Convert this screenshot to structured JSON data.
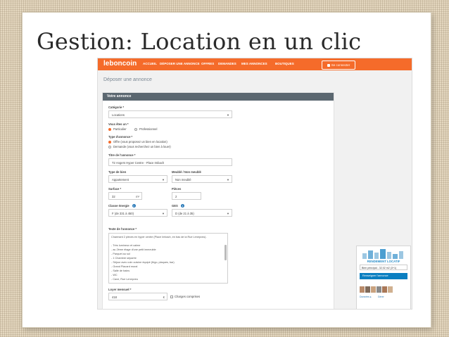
{
  "slide": {
    "title": "Gestion: Location en un clic"
  },
  "site": {
    "logo": "leboncoin",
    "nav": [
      "ACCUEIL",
      "DÉPOSER UNE ANNONCE",
      "OFFRES",
      "DEMANDES",
      "MES ANNONCES",
      "BOUTIQUES"
    ],
    "connect_label": "Se connecter",
    "brand_color": "#f56b2a"
  },
  "page": {
    "heading": "Déposer une annonce"
  },
  "form": {
    "panel_title": "Votre annonce",
    "category_label": "Catégorie *",
    "category_value": "Locations",
    "vous_etes_label": "Vous êtes un *",
    "vous_etes_options": [
      "Particulier",
      "Professionnel"
    ],
    "type_label": "Type d'annonce *",
    "type_options": [
      "Offre (vous proposez un bien en location)",
      "Demande (vous recherchez un bien à louer)"
    ],
    "titre_label": "Titre de l'annonce *",
    "titre_value": "T2 Angers Hyper Centre - Place Imbach",
    "type_bien_label": "Type de bien",
    "type_bien_value": "Appartement",
    "meuble_label": "Meublé / Non meublé",
    "meuble_value": "Non meublé",
    "surface_label": "Surface *",
    "surface_value": "32",
    "surface_unit": "m²",
    "pieces_label": "Pièces",
    "pieces_value": "2",
    "classe_label": "Classe énergie",
    "classe_value": "F (de 331 à 450)",
    "ges_label": "GES",
    "ges_value": "D (de 21 à 35)",
    "texte_label": "Texte de l'annonce *",
    "texte_lines": [
      "Charmant 2 pièces en hyper centre (Place Imbach, en bas de la Rue Lenepveu).",
      "",
      "- Très lumineux et calme",
      "- au 2ème étage d'une petit immeuble",
      "- Parquet au sol",
      "- 1 Chambre séparée",
      "- Séjour avec coin cuisine équipé (frigo, plaques, bar)",
      "- Grand Placard mural",
      "- Salle de bains",
      "- WC",
      "- Cave, Rue Lenepveu"
    ],
    "loyer_label": "Loyer mensuel *",
    "loyer_value": "418",
    "loyer_unit": "€",
    "charges_label": "Charges comprises"
  },
  "widget": {
    "brand": "RENDEMENT LOCATIF",
    "select_value": "Bien principal - 32.02 m2 (3+1)",
    "button_label": "Renseigner l'annonce",
    "footer_left": "Données ▸",
    "footer_right": "Gérer"
  }
}
